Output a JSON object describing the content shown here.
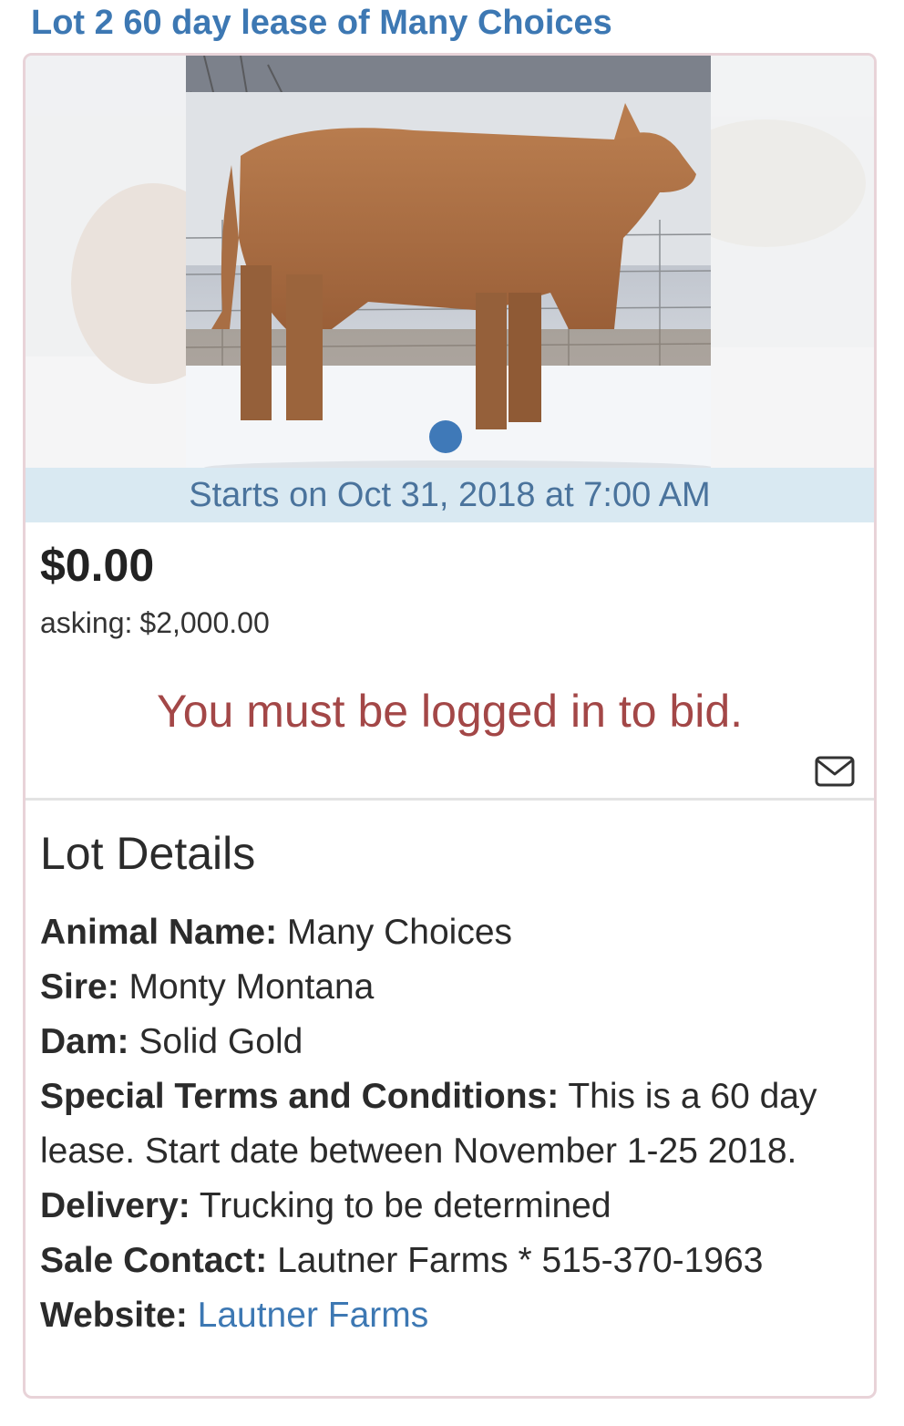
{
  "lot": {
    "title": "Lot 2 60 day lease of Many Choices",
    "starts": "Starts on Oct 31, 2018 at 7:00 AM",
    "current_bid": "$0.00",
    "asking_label": "asking:",
    "asking_value": "$2,000.00",
    "login_message": "You must be logged in to bid."
  },
  "details": {
    "heading": "Lot Details",
    "animal_name_label": "Animal Name:",
    "animal_name": "Many Choices",
    "sire_label": "Sire:",
    "sire": "Monty Montana",
    "dam_label": "Dam:",
    "dam": "Solid Gold",
    "terms_label": "Special Terms and Conditions:",
    "terms": "This is a 60 day lease. Start date between November 1-25 2018.",
    "delivery_label": "Delivery:",
    "delivery": "Trucking to be determined",
    "contact_label": "Sale Contact:",
    "contact": "Lautner Farms * 515-370-1963",
    "website_label": "Website:",
    "website": "Lautner Farms"
  },
  "colors": {
    "link": "#3d78b3",
    "banner_bg": "#d9e9f2",
    "banner_text": "#4a739c",
    "warning_text": "#a34747",
    "card_border": "#e8d3d8"
  },
  "icons": {
    "contact": "envelope-icon",
    "carousel_indicator": "carousel-dot"
  }
}
